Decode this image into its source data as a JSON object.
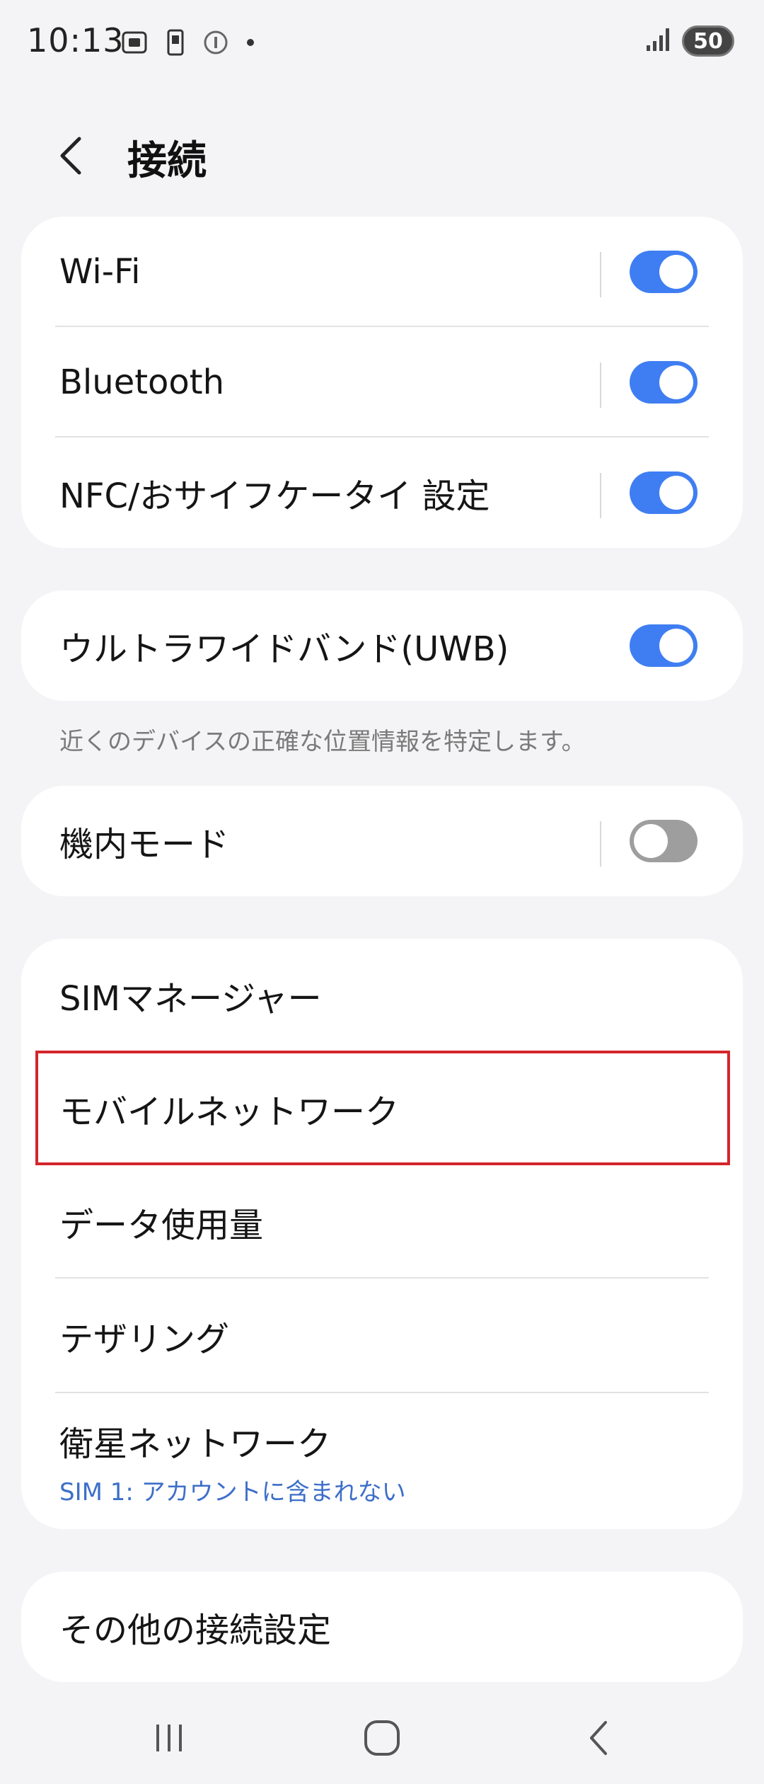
{
  "status": {
    "time": "10:13",
    "battery": "50"
  },
  "header": {
    "title": "接続"
  },
  "group1": [
    {
      "label": "Wi-Fi",
      "toggle": true
    },
    {
      "label": "Bluetooth",
      "toggle": true
    },
    {
      "label": "NFC/おサイフケータイ 設定",
      "toggle": true
    }
  ],
  "uwb": {
    "label": "ウルトラワイドバンド(UWB)",
    "toggle": true,
    "note": "近くのデバイスの正確な位置情報を特定します。"
  },
  "airplane": {
    "label": "機内モード",
    "toggle": false
  },
  "group2": {
    "sim_manager": "SIMマネージャー",
    "mobile_network": "モバイルネットワーク",
    "data_usage": "データ使用量",
    "tethering": "テザリング",
    "satellite": "衛星ネットワーク",
    "satellite_sub": "SIM 1: アカウントに含まれない"
  },
  "other": {
    "label": "その他の接続設定"
  },
  "colors": {
    "accent": "#3f7ef2",
    "highlight": "#d3262c",
    "background": "#f4f4f6"
  }
}
